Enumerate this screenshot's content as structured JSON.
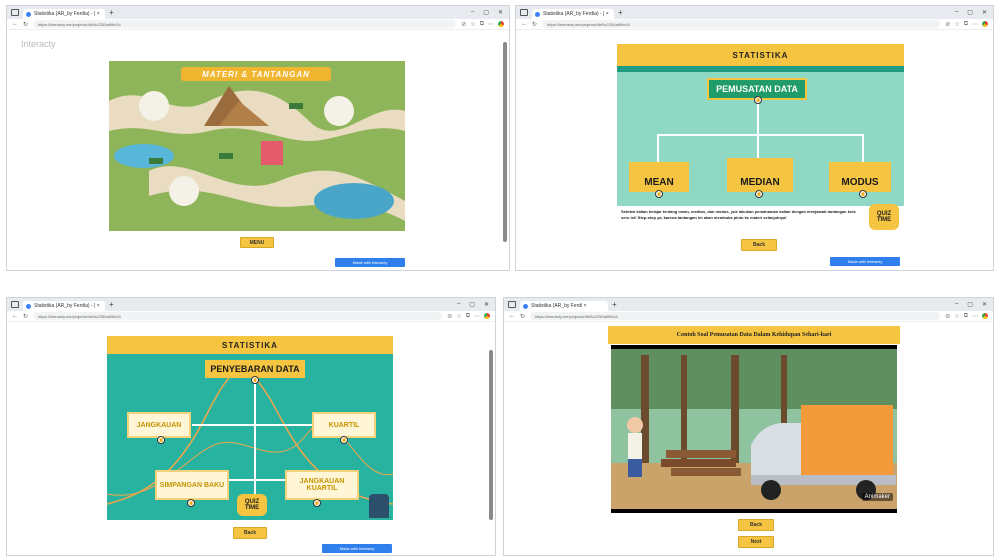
{
  "browser": {
    "tab1_title": "Statistika (AR_by Ferdia) - | ×",
    "tab2_title": "Statistika (AR_by Ferdia) - | ×",
    "tab3_title": "Statistika (AR_by Ferdia) - | ×",
    "tab4_title": "Statistika (AR_by Ferdi ×",
    "url1": "https://interacty.me/projects/4bf4c2250a89fc04",
    "url2": "https://interacty.me/projects/4bf4c2250a89fc04",
    "url3": "https://interacty.me/projects/4bf4c2250a89fc04",
    "url4": "https://interacty.me/projects/4bf4c2250a89fc04",
    "logo": "Interacty"
  },
  "panel1": {
    "title": "MATERI & TANTANGAN",
    "menu_button": "MENU",
    "made_with": "Made with  Interacty"
  },
  "panel2": {
    "header": "STATISTIKA",
    "topic": "PEMUSATAN DATA",
    "items": [
      "MEAN",
      "MEDIAN",
      "MODUS"
    ],
    "desc": "Setelah kalian belajar tentang mean, median, dan modus, yuk lakukan pemahaman kalian dengan menjawab tantangan kuis seru ini! Step-step ya, karena tantangan ini akan membuka pintu ke materi selanjutnya!",
    "quiz": "QUIZ TIME",
    "back_button": "Back",
    "made_with": "Made with  Interacty"
  },
  "panel3": {
    "header": "STATISTIKA",
    "topic": "PENYEBARAN DATA",
    "items": [
      "JANGKAUAN",
      "KUARTIL",
      "SIMPANGAN BAKU",
      "JANGKAUAN KUARTIL"
    ],
    "quiz": "QUIZ TIME",
    "back_button": "Back",
    "made_with": "Made with  Interacty"
  },
  "panel4": {
    "title": "Contoh Soal Pemusatan Data Dalam Kehidupan Sehari-hari",
    "watermark": "Animaker",
    "back_button": "Back",
    "next_button": "Next"
  }
}
